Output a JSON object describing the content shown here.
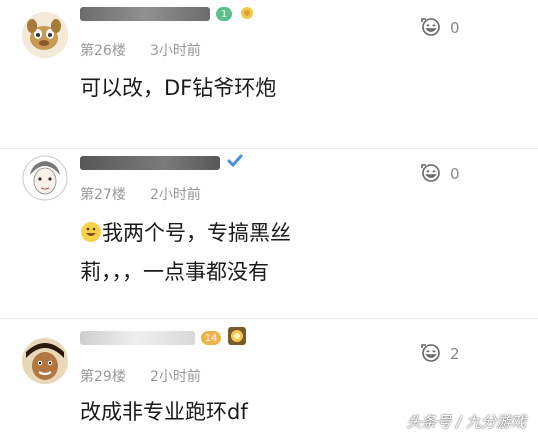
{
  "comments": [
    {
      "floor": "第26楼",
      "time": "3小时前",
      "likes": "0",
      "badge": "1",
      "text_lines": [
        "可以改，DF钻爷环炮"
      ]
    },
    {
      "floor": "第27楼",
      "time": "2小时前",
      "likes": "0",
      "text_lines": [
        "我两个号，专搞黑丝",
        "莉，，，一点事都没有"
      ],
      "line1_tail": "，专搞黑丝"
    },
    {
      "floor": "第29楼",
      "time": "2小时前",
      "likes": "2",
      "badge": "14",
      "text_lines": [
        "改成非专业跑环df"
      ]
    }
  ],
  "watermark": "头条号 / 九分游戏",
  "colors": {
    "meta_gray": "#999999",
    "badge_green": "#5cc08a",
    "badge_orange": "#f0b24a",
    "verified_blue": "#4a90e2"
  },
  "icons": {
    "like": "grin-face-icon",
    "emoji_inline": "grinning-emoji-icon"
  }
}
